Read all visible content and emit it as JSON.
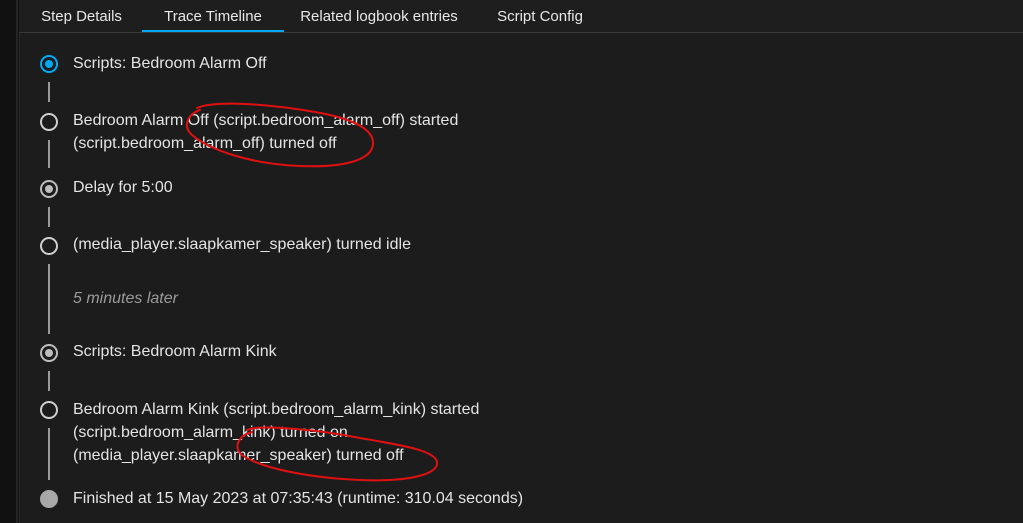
{
  "tabs": [
    {
      "label": "Step Details"
    },
    {
      "label": "Trace Timeline"
    },
    {
      "label": "Related logbook entries"
    },
    {
      "label": "Script Config"
    }
  ],
  "timeline": {
    "entry1": "Scripts: Bedroom Alarm Off",
    "entry2_line1": "Bedroom Alarm Off (script.bedroom_alarm_off) started",
    "entry2_line2": "(script.bedroom_alarm_off) turned off",
    "entry3": "Delay for 5:00",
    "entry4": "(media_player.slaapkamer_speaker) turned idle",
    "gap": "5 minutes later",
    "entry5": "Scripts: Bedroom Alarm Kink",
    "entry6_line1": "Bedroom Alarm Kink (script.bedroom_alarm_kink) started",
    "entry6_line2": "(script.bedroom_alarm_kink) turned on",
    "entry6_line3": "(media_player.slaapkamer_speaker) turned off",
    "entry7": "Finished at 15 May 2023 at 07:35:43 (runtime: 310.04 seconds)"
  },
  "colors": {
    "accent": "#03a9f4",
    "annotation": "#e01010",
    "background": "#1c1c1c"
  }
}
